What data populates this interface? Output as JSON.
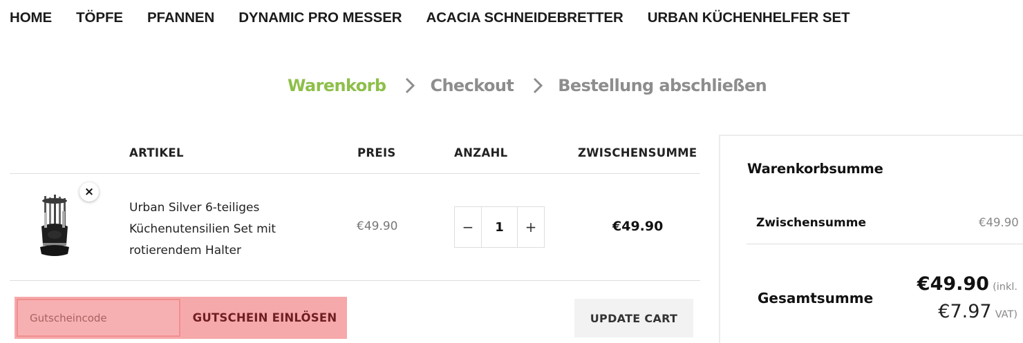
{
  "nav": {
    "items": [
      "HOME",
      "TÖPFE",
      "PFANNEN",
      "DYNAMIC PRO MESSER",
      "ACACIA SCHNEIDEBRETTER",
      "URBAN KÜCHENHELFER SET"
    ]
  },
  "steps": {
    "items": [
      "Warenkorb",
      "Checkout",
      "Bestellung abschließen"
    ],
    "active_color": "#8dbf4a",
    "inactive_color": "#8d8d8d"
  },
  "cart": {
    "headers": {
      "article": "ARTIKEL",
      "price": "PREIS",
      "quantity": "ANZAHL",
      "subtotal": "ZWISCHENSUMME"
    },
    "items": [
      {
        "name": "Urban Silver 6-teiliges Küchenutensilien Set mit rotierendem Halter",
        "price": "€49.90",
        "quantity": "1",
        "subtotal": "€49.90",
        "remove_icon": "×"
      }
    ],
    "qty_minus": "−",
    "qty_plus": "+",
    "coupon_placeholder": "Gutscheincode",
    "coupon_button": "GUTSCHEIN EINLÖSEN",
    "update_button": "UPDATE CART"
  },
  "totals": {
    "title": "Warenkorbsumme",
    "subtotal_label": "Zwischensumme",
    "subtotal_value": "€49.90",
    "total_label": "Gesamtsumme",
    "total_value": "€49.90",
    "incl_prefix": "(inkl.",
    "vat_value": "€7.97",
    "vat_suffix": "VAT)"
  }
}
